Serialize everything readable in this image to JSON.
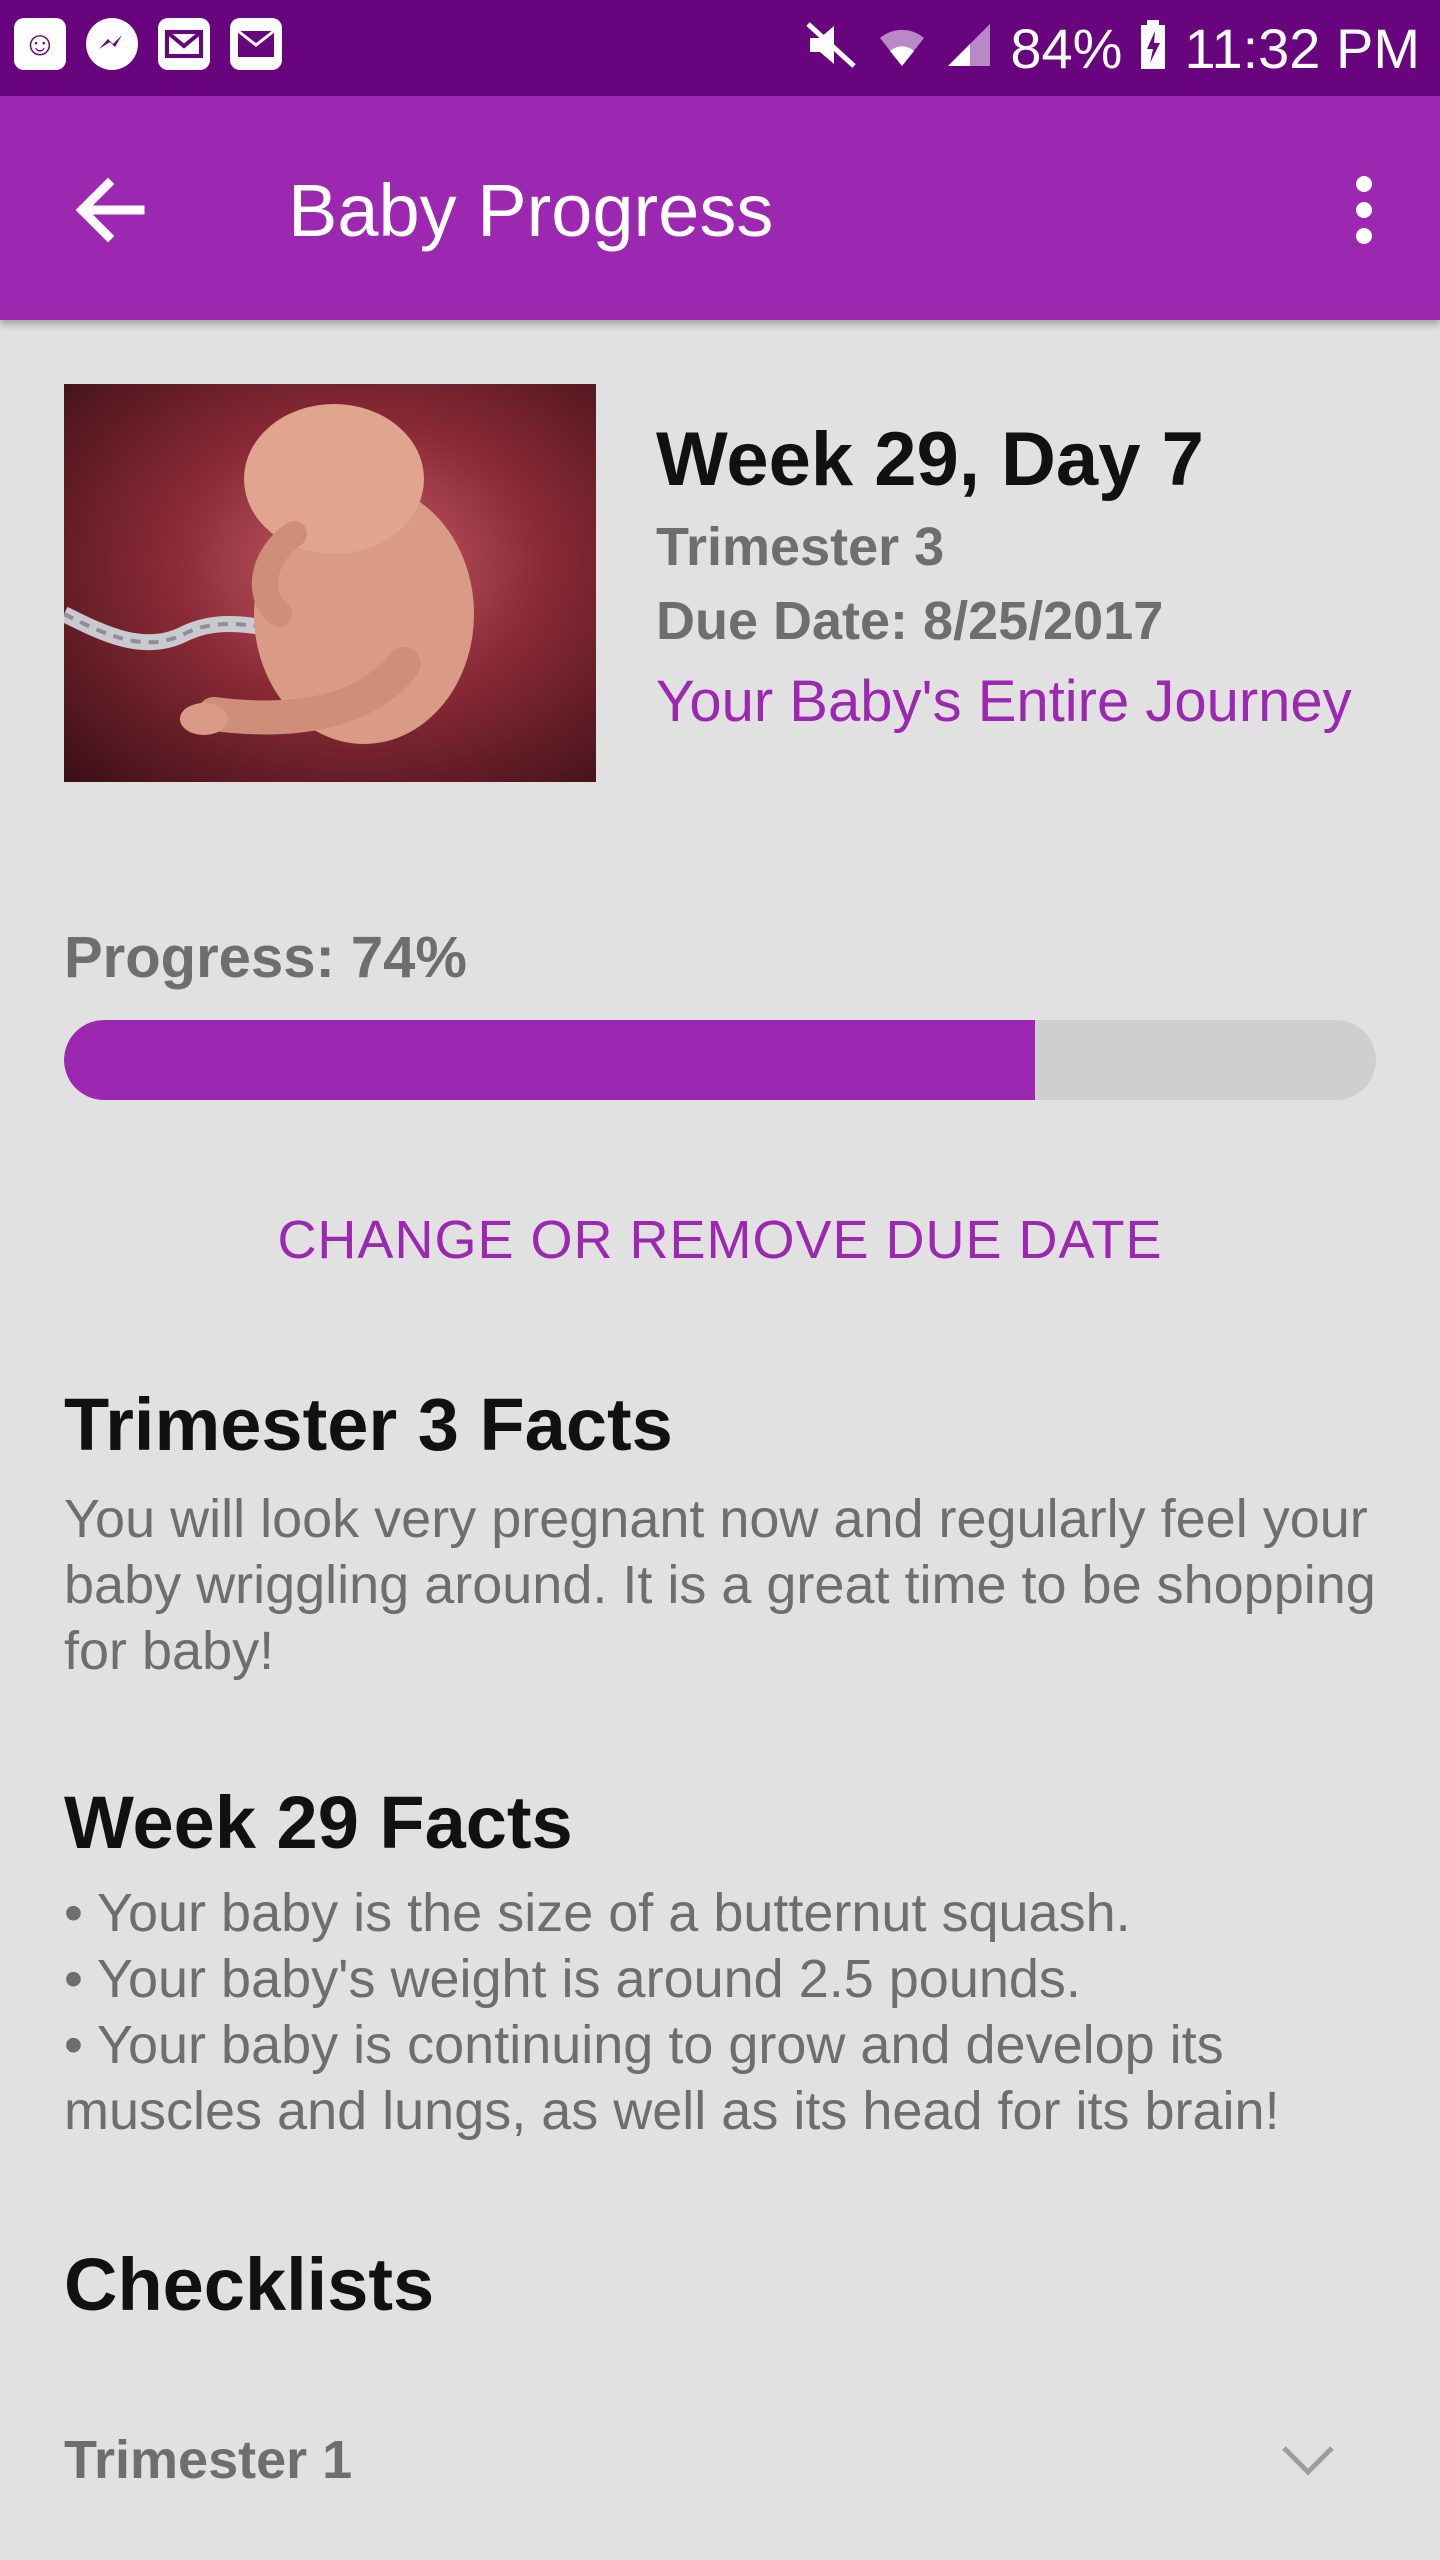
{
  "status_bar": {
    "battery": "84%",
    "time": "11:32 PM",
    "notification_icons": [
      "app-icon",
      "messenger-icon",
      "gmail-icon",
      "mail-icon"
    ],
    "system_icons": [
      "mute-icon",
      "wifi-icon",
      "signal-icon",
      "battery-charging-icon"
    ]
  },
  "app_bar": {
    "title": "Baby Progress",
    "back_icon": "arrow-left-icon",
    "menu_icon": "more-vertical-icon",
    "color": "#9c27b0"
  },
  "hero": {
    "week_day": "Week 29, Day 7",
    "trimester": "Trimester 3",
    "due_date": "Due Date: 8/25/2017",
    "journey_link": "Your Baby's Entire Journey"
  },
  "progress": {
    "label": "Progress: 74%",
    "value": 0.74
  },
  "change_due_date_label": "CHANGE OR REMOVE DUE DATE",
  "trimester_facts": {
    "heading": "Trimester 3 Facts",
    "body": "You will look very pregnant now and regularly feel your baby wriggling around. It is a great time to be shopping for baby!"
  },
  "week_facts": {
    "heading": "Week 29 Facts",
    "items": [
      "• Your baby is the size of a butternut squash.",
      "• Your baby's weight is around 2.5 pounds.",
      "• Your baby is continuing to grow and develop its muscles and lungs, as well as its head for its brain!"
    ]
  },
  "checklists": {
    "heading": "Checklists",
    "items": [
      {
        "label": "Trimester 1",
        "icon": "chevron-down-icon"
      }
    ]
  }
}
